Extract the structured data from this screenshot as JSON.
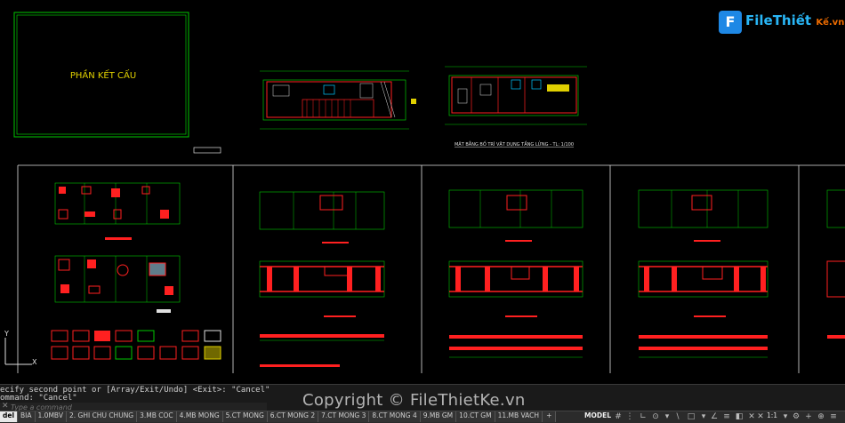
{
  "drawing": {
    "cover_title": "PHẦN KẾT CẤU",
    "plan_caption": "MẶT BẰNG BỐ TRÍ VẬT DỤNG TẦNG LỬNG - TL: 1/100",
    "ucs_x": "X",
    "ucs_y": "Y"
  },
  "logo": {
    "icon_letter": "F",
    "name": "FileThiết",
    "suffix": "Kế.vn"
  },
  "command": {
    "history_line1": "ecify second point or [Array/Exit/Undo] <Exit>: \"Cancel\"",
    "history_line2": "ommand: \"Cancel\"",
    "placeholder": "Type a command"
  },
  "watermark": "Copyright © FileThietKe.vn",
  "status": {
    "tabs": [
      "del",
      "BIA",
      "1.0MBV",
      "2. GHI CHU CHUNG",
      "3.MB COC",
      "4.MB MONG",
      "5.CT MONG",
      "6.CT MONG 2",
      "7.CT MONG 3",
      "8.CT MONG 4",
      "9.MB GM",
      "10.CT GM",
      "11.MB VACH",
      "+"
    ],
    "model_label": "MODEL",
    "scale": "1:1"
  },
  "colors": {
    "background": "#000000",
    "green": "#00c800",
    "red": "#ff2020",
    "yellow": "#e0d000",
    "cyan": "#00c8ff",
    "white": "#e0e0e0"
  }
}
